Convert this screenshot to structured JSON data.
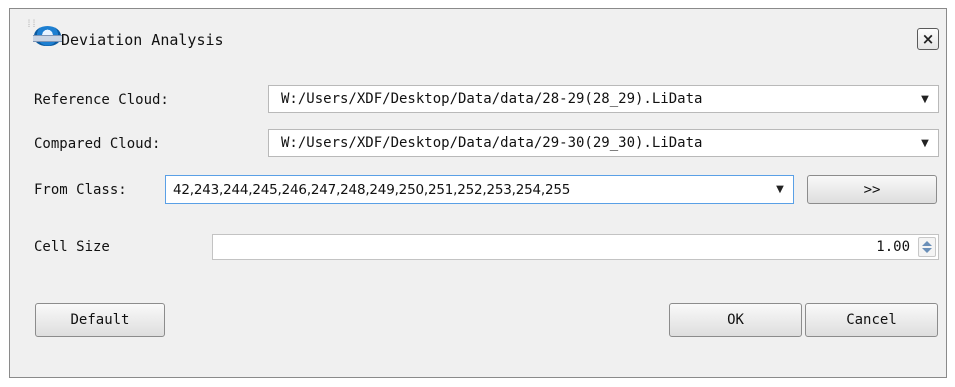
{
  "window": {
    "title": "Deviation Analysis",
    "close_glyph": "×",
    "grip_glyph": "⁞⁞"
  },
  "form": {
    "reference_cloud": {
      "label": "Reference Cloud:",
      "value": "W:/Users/XDF/Desktop/Data/data/28-29(28_29).LiData"
    },
    "compared_cloud": {
      "label": "Compared Cloud:",
      "value": "W:/Users/XDF/Desktop/Data/data/29-30(29_30).LiData"
    },
    "from_class": {
      "label": "From Class:",
      "value": "42,243,244,245,246,247,248,249,250,251,252,253,254,255",
      "button_label": ">>"
    },
    "cell_size": {
      "label": "Cell Size",
      "value": "1.00"
    }
  },
  "buttons": {
    "default": "Default",
    "ok": "OK",
    "cancel": "Cancel"
  },
  "icons": {
    "dropdown_arrow": "▼",
    "app_icon": "lidar-app-icon"
  }
}
